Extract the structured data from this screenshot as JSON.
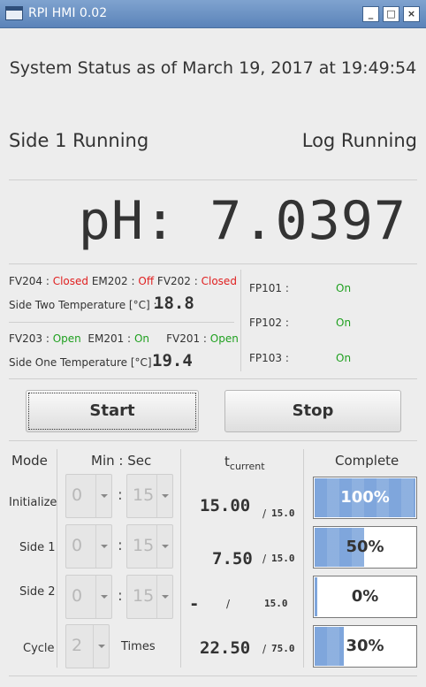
{
  "window": {
    "title": "RPI HMI 0.02",
    "controls": [
      "_",
      "□",
      "×"
    ]
  },
  "header": {
    "status_line": "System Status as of March 19, 2017 at 19:49:54"
  },
  "status": {
    "side": "Side 1 Running",
    "log": "Log Running"
  },
  "ph": {
    "label": "pH:",
    "value": "7.0397"
  },
  "valves_side2": [
    {
      "name": "FV204 :",
      "state": "Closed"
    },
    {
      "name": "EM202 :",
      "state": "Off"
    },
    {
      "name": "FV202 :",
      "state": "Closed"
    }
  ],
  "side2_temp": {
    "label": "Side Two Temperature [°C] :",
    "value": "18.8"
  },
  "valves_side1": [
    {
      "name": "FV203 :",
      "state": "Open"
    },
    {
      "name": "EM201 :",
      "state": "On"
    },
    {
      "name": "FV201 :",
      "state": "Open"
    }
  ],
  "side1_temp": {
    "label": "Side One Temperature [°C] :",
    "value": "19.4"
  },
  "pumps": [
    {
      "name": "FP101 :",
      "state": "On"
    },
    {
      "name": "FP102 :",
      "state": "On"
    },
    {
      "name": "FP103 :",
      "state": "On"
    }
  ],
  "buttons": {
    "start": "Start",
    "stop": "Stop"
  },
  "table": {
    "headers": {
      "mode": "Mode",
      "minsec": "Min : Sec",
      "t": "t",
      "t_sub": "current",
      "complete": "Complete"
    },
    "rows": [
      {
        "label": "Initialize",
        "min": "0",
        "sec": "15",
        "current": "15.00",
        "slash": "/",
        "total": "15.0",
        "pct_label": "100%",
        "pct": 1.0
      },
      {
        "label": "Side 1",
        "min": "0",
        "sec": "15",
        "current": "7.50",
        "slash": "/",
        "total": "15.0",
        "pct_label": "50%",
        "pct": 0.5
      },
      {
        "label": "Side 2",
        "min": "0",
        "sec": "15",
        "current": "-",
        "slash": "/",
        "total": "15.0",
        "pct_label": "0%",
        "pct": 0.0
      },
      {
        "label": "Cycle",
        "count": "2",
        "count_suffix": "Times",
        "current": "22.50",
        "slash": "/",
        "total": "75.0",
        "pct_label": "30%",
        "pct": 0.3
      }
    ],
    "colon": ":"
  },
  "colors": {
    "closed": "#e02020",
    "open": "#1fa01f",
    "progress": "#7fa6dc",
    "titlebar": "#5b83b9"
  }
}
